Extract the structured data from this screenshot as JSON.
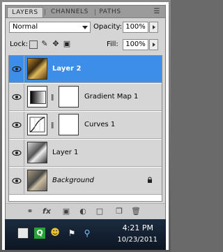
{
  "tabs": {
    "layers": "LAYERS",
    "channels": "CHANNELS",
    "paths": "PATHS",
    "menu_icon": "panel-menu-icon"
  },
  "blend_mode": {
    "value": "Normal"
  },
  "opacity": {
    "label": "Opacity:",
    "value": "100%"
  },
  "lock": {
    "label": "Lock:"
  },
  "fill": {
    "label": "Fill:",
    "value": "100%"
  },
  "layers": [
    {
      "name": "Layer 2",
      "selected": true,
      "type": "pixel"
    },
    {
      "name": "Gradient Map 1",
      "selected": false,
      "type": "adjustment"
    },
    {
      "name": "Curves 1",
      "selected": false,
      "type": "adjustment"
    },
    {
      "name": "Layer 1",
      "selected": false,
      "type": "pixel"
    },
    {
      "name": "Background",
      "selected": false,
      "type": "background",
      "locked": true
    }
  ],
  "bottom_icons": [
    "link-layers-icon",
    "fx-icon",
    "add-mask-icon",
    "adjustment-layer-icon",
    "new-group-icon",
    "new-layer-icon",
    "trash-icon"
  ],
  "taskbar": {
    "time": "4:21 PM",
    "date": "10/23/2011"
  },
  "colors": {
    "selection": "#3c8ee8",
    "panel": "#d5d5d5",
    "taskbar": "#14202f"
  }
}
